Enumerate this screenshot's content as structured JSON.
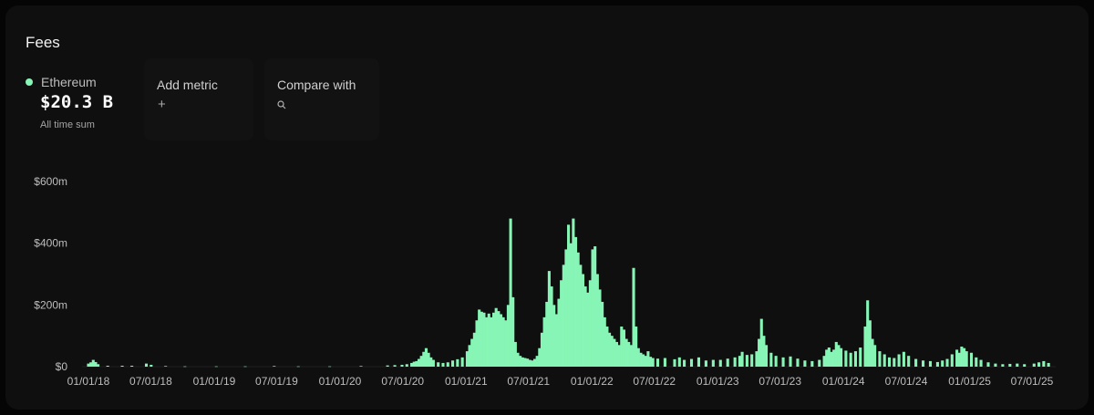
{
  "panel": {
    "title": "Fees",
    "series_name": "Ethereum",
    "series_color": "#86f5b5",
    "value": "$20.3 B",
    "value_caption": "All time sum",
    "add_metric_label": "Add metric",
    "add_icon": "+",
    "compare_label": "Compare with",
    "search_icon": "search-icon"
  },
  "chart_data": {
    "type": "bar",
    "title": "Fees",
    "xlabel": "",
    "ylabel": "",
    "ylim": [
      0,
      600
    ],
    "y_unit": "millions USD",
    "y_ticks": [
      {
        "value": 0,
        "label": "$0"
      },
      {
        "value": 200,
        "label": "$200m"
      },
      {
        "value": 400,
        "label": "$400m"
      },
      {
        "value": 600,
        "label": "$600m"
      }
    ],
    "x_ticks": [
      "01/01/18",
      "07/01/18",
      "01/01/19",
      "07/01/19",
      "01/01/20",
      "07/01/20",
      "01/01/21",
      "07/01/21",
      "01/01/22",
      "07/01/22",
      "01/01/23",
      "07/01/23",
      "01/01/24",
      "07/01/24",
      "01/01/25",
      "07/01/25"
    ],
    "grid": false,
    "color": "#86f5b5",
    "series": [
      {
        "name": "Ethereum",
        "points": [
          [
            "2018-01-01",
            10
          ],
          [
            "2018-01-08",
            14
          ],
          [
            "2018-01-15",
            22
          ],
          [
            "2018-01-22",
            15
          ],
          [
            "2018-01-29",
            8
          ],
          [
            "2018-02-26",
            3
          ],
          [
            "2018-04-09",
            3
          ],
          [
            "2018-05-07",
            3
          ],
          [
            "2018-06-18",
            10
          ],
          [
            "2018-07-02",
            6
          ],
          [
            "2018-08-13",
            2
          ],
          [
            "2018-10-08",
            1
          ],
          [
            "2019-01-07",
            1
          ],
          [
            "2019-04-01",
            1
          ],
          [
            "2019-06-24",
            2
          ],
          [
            "2019-09-02",
            1
          ],
          [
            "2019-12-02",
            1
          ],
          [
            "2020-03-02",
            2
          ],
          [
            "2020-05-18",
            4
          ],
          [
            "2020-06-08",
            5
          ],
          [
            "2020-06-29",
            6
          ],
          [
            "2020-07-13",
            8
          ],
          [
            "2020-07-27",
            12
          ],
          [
            "2020-08-03",
            16
          ],
          [
            "2020-08-10",
            18
          ],
          [
            "2020-08-17",
            25
          ],
          [
            "2020-08-24",
            35
          ],
          [
            "2020-08-31",
            48
          ],
          [
            "2020-09-07",
            60
          ],
          [
            "2020-09-14",
            45
          ],
          [
            "2020-09-21",
            30
          ],
          [
            "2020-09-28",
            22
          ],
          [
            "2020-10-12",
            14
          ],
          [
            "2020-10-26",
            12
          ],
          [
            "2020-11-09",
            14
          ],
          [
            "2020-11-23",
            20
          ],
          [
            "2020-12-07",
            24
          ],
          [
            "2020-12-21",
            30
          ],
          [
            "2021-01-04",
            50
          ],
          [
            "2021-01-11",
            70
          ],
          [
            "2021-01-18",
            90
          ],
          [
            "2021-01-25",
            110
          ],
          [
            "2021-02-01",
            150
          ],
          [
            "2021-02-08",
            185
          ],
          [
            "2021-02-15",
            178
          ],
          [
            "2021-02-22",
            175
          ],
          [
            "2021-03-01",
            160
          ],
          [
            "2021-03-08",
            172
          ],
          [
            "2021-03-15",
            160
          ],
          [
            "2021-03-22",
            175
          ],
          [
            "2021-03-29",
            190
          ],
          [
            "2021-04-05",
            180
          ],
          [
            "2021-04-12",
            170
          ],
          [
            "2021-04-19",
            160
          ],
          [
            "2021-04-26",
            150
          ],
          [
            "2021-05-03",
            200
          ],
          [
            "2021-05-10",
            480
          ],
          [
            "2021-05-17",
            225
          ],
          [
            "2021-05-24",
            80
          ],
          [
            "2021-05-31",
            45
          ],
          [
            "2021-06-07",
            35
          ],
          [
            "2021-06-14",
            30
          ],
          [
            "2021-06-21",
            28
          ],
          [
            "2021-06-28",
            26
          ],
          [
            "2021-07-05",
            22
          ],
          [
            "2021-07-12",
            20
          ],
          [
            "2021-07-19",
            25
          ],
          [
            "2021-07-26",
            35
          ],
          [
            "2021-08-02",
            60
          ],
          [
            "2021-08-09",
            110
          ],
          [
            "2021-08-16",
            160
          ],
          [
            "2021-08-23",
            210
          ],
          [
            "2021-08-30",
            310
          ],
          [
            "2021-09-06",
            260
          ],
          [
            "2021-09-13",
            200
          ],
          [
            "2021-09-20",
            170
          ],
          [
            "2021-09-27",
            220
          ],
          [
            "2021-10-04",
            280
          ],
          [
            "2021-10-11",
            330
          ],
          [
            "2021-10-18",
            380
          ],
          [
            "2021-10-25",
            460
          ],
          [
            "2021-11-01",
            400
          ],
          [
            "2021-11-08",
            480
          ],
          [
            "2021-11-15",
            420
          ],
          [
            "2021-11-22",
            370
          ],
          [
            "2021-11-29",
            330
          ],
          [
            "2021-12-06",
            300
          ],
          [
            "2021-12-13",
            260
          ],
          [
            "2021-12-20",
            240
          ],
          [
            "2021-12-27",
            280
          ],
          [
            "2022-01-03",
            380
          ],
          [
            "2022-01-10",
            390
          ],
          [
            "2022-01-17",
            300
          ],
          [
            "2022-01-24",
            250
          ],
          [
            "2022-01-31",
            210
          ],
          [
            "2022-02-07",
            160
          ],
          [
            "2022-02-14",
            130
          ],
          [
            "2022-02-21",
            110
          ],
          [
            "2022-02-28",
            100
          ],
          [
            "2022-03-07",
            90
          ],
          [
            "2022-03-14",
            80
          ],
          [
            "2022-03-21",
            70
          ],
          [
            "2022-03-28",
            130
          ],
          [
            "2022-04-04",
            120
          ],
          [
            "2022-04-11",
            90
          ],
          [
            "2022-04-18",
            80
          ],
          [
            "2022-04-25",
            70
          ],
          [
            "2022-05-02",
            320
          ],
          [
            "2022-05-09",
            130
          ],
          [
            "2022-05-16",
            60
          ],
          [
            "2022-05-23",
            45
          ],
          [
            "2022-05-30",
            40
          ],
          [
            "2022-06-06",
            35
          ],
          [
            "2022-06-13",
            50
          ],
          [
            "2022-06-20",
            32
          ],
          [
            "2022-06-27",
            28
          ],
          [
            "2022-07-11",
            26
          ],
          [
            "2022-08-01",
            28
          ],
          [
            "2022-08-29",
            24
          ],
          [
            "2022-09-12",
            30
          ],
          [
            "2022-09-26",
            22
          ],
          [
            "2022-10-17",
            25
          ],
          [
            "2022-11-07",
            30
          ],
          [
            "2022-11-28",
            20
          ],
          [
            "2022-12-19",
            22
          ],
          [
            "2023-01-09",
            22
          ],
          [
            "2023-01-30",
            26
          ],
          [
            "2023-02-20",
            30
          ],
          [
            "2023-03-06",
            35
          ],
          [
            "2023-03-13",
            48
          ],
          [
            "2023-03-27",
            38
          ],
          [
            "2023-04-10",
            40
          ],
          [
            "2023-04-24",
            50
          ],
          [
            "2023-05-01",
            90
          ],
          [
            "2023-05-08",
            155
          ],
          [
            "2023-05-15",
            100
          ],
          [
            "2023-05-22",
            70
          ],
          [
            "2023-06-05",
            45
          ],
          [
            "2023-06-19",
            35
          ],
          [
            "2023-07-10",
            30
          ],
          [
            "2023-07-31",
            33
          ],
          [
            "2023-08-21",
            26
          ],
          [
            "2023-09-11",
            20
          ],
          [
            "2023-10-02",
            18
          ],
          [
            "2023-10-23",
            22
          ],
          [
            "2023-11-06",
            35
          ],
          [
            "2023-11-13",
            55
          ],
          [
            "2023-11-20",
            62
          ],
          [
            "2023-11-27",
            48
          ],
          [
            "2023-12-04",
            55
          ],
          [
            "2023-12-11",
            80
          ],
          [
            "2023-12-18",
            70
          ],
          [
            "2023-12-25",
            60
          ],
          [
            "2024-01-08",
            52
          ],
          [
            "2024-01-22",
            45
          ],
          [
            "2024-02-05",
            50
          ],
          [
            "2024-02-19",
            62
          ],
          [
            "2024-03-04",
            130
          ],
          [
            "2024-03-11",
            215
          ],
          [
            "2024-03-18",
            150
          ],
          [
            "2024-03-25",
            90
          ],
          [
            "2024-04-01",
            70
          ],
          [
            "2024-04-15",
            50
          ],
          [
            "2024-04-29",
            40
          ],
          [
            "2024-05-13",
            30
          ],
          [
            "2024-05-27",
            28
          ],
          [
            "2024-06-10",
            40
          ],
          [
            "2024-06-24",
            48
          ],
          [
            "2024-07-08",
            35
          ],
          [
            "2024-07-29",
            25
          ],
          [
            "2024-08-19",
            20
          ],
          [
            "2024-09-09",
            18
          ],
          [
            "2024-09-30",
            15
          ],
          [
            "2024-10-14",
            20
          ],
          [
            "2024-10-28",
            25
          ],
          [
            "2024-11-11",
            40
          ],
          [
            "2024-11-25",
            55
          ],
          [
            "2024-12-02",
            45
          ],
          [
            "2024-12-09",
            65
          ],
          [
            "2024-12-16",
            60
          ],
          [
            "2024-12-23",
            50
          ],
          [
            "2025-01-06",
            45
          ],
          [
            "2025-01-20",
            30
          ],
          [
            "2025-02-03",
            22
          ],
          [
            "2025-02-24",
            14
          ],
          [
            "2025-03-17",
            10
          ],
          [
            "2025-04-07",
            8
          ],
          [
            "2025-04-28",
            9
          ],
          [
            "2025-05-19",
            10
          ],
          [
            "2025-06-09",
            8
          ],
          [
            "2025-07-07",
            10
          ],
          [
            "2025-07-21",
            14
          ],
          [
            "2025-08-04",
            18
          ],
          [
            "2025-08-18",
            12
          ]
        ]
      }
    ]
  }
}
